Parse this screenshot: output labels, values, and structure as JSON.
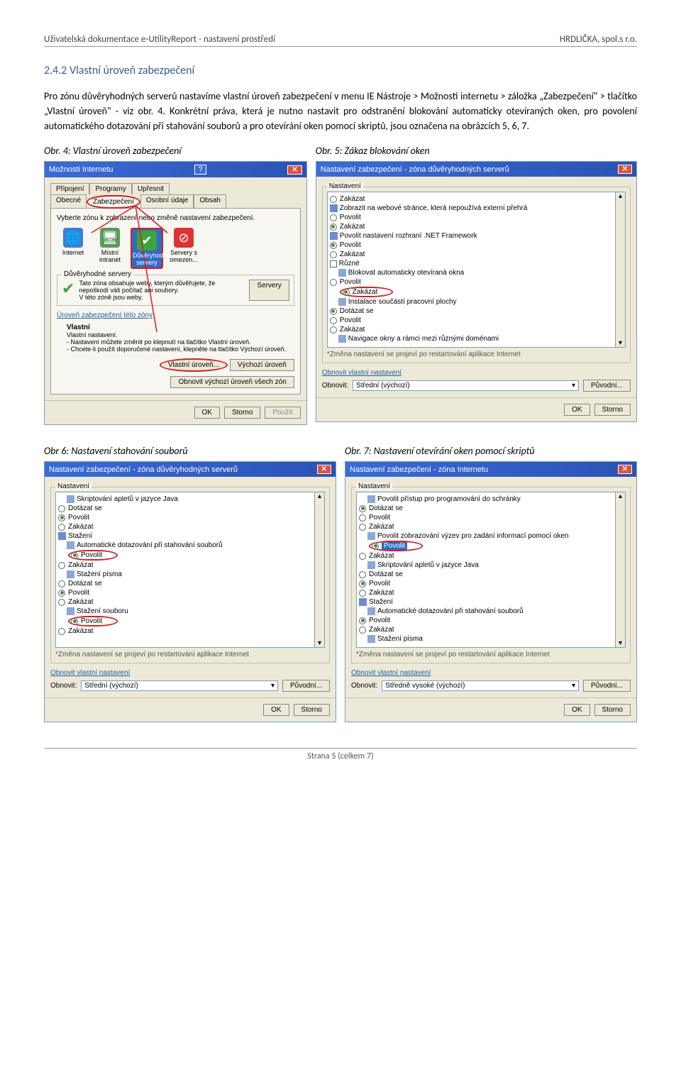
{
  "header": {
    "left": "Uživatelská dokumentace e-UtilityReport  - nastavení prostředí",
    "right": "HRDLIČKA, spol.s r.o."
  },
  "section": {
    "heading": "2.4.2    Vlastní úroveň zabezpečení",
    "body": "Pro zónu důvěryhodných serverů nastavíme vlastní úroveň zabezpečení v menu IE Nástroje > Možnosti internetu > záložka „Zabezpečení\" > tlačítko „Vlastní úroveň\" - viz obr. 4. Konkrétní práva, která je nutno nastavit pro odstranění blokování automaticky otevíraných oken, pro povolení automatického dotazování při stahování souborů a pro otevírání oken pomocí skriptů, jsou označena na obrázcích 5, 6, 7."
  },
  "figs": {
    "f4": {
      "cap": "Obr. 4: Vlastní úroveň zabezpečení"
    },
    "f5": {
      "cap": "Obr. 5: Zákaz blokování  oken"
    },
    "f6": {
      "cap": "Obr 6: Nastavení stahování souborů"
    },
    "f7": {
      "cap": "Obr. 7: Nastavení otevírání oken pomocí skriptů"
    }
  },
  "dlg4": {
    "title": "Možnosti Internetu",
    "tabs_row1": [
      "Připojení",
      "Programy",
      "Upřesnit"
    ],
    "tabs_row2": [
      "Obecné",
      "Zabezpečení",
      "Osobní údaje",
      "Obsah"
    ],
    "zone_prompt": "Vyberte zónu k zobrazení nebo změně nastavení zabezpečení.",
    "zones": [
      "Internet",
      "Místní intranet",
      "Důvěryhodné servery",
      "Servery s omezen..."
    ],
    "trusted_h": "Důvěryhodné servery",
    "trusted_desc": "Tato zóna obsahuje weby, kterým důvěřujete, že nepoškodí váš počítač ani soubory.\nV této zóně jsou weby.",
    "btn_servers": "Servery",
    "level_h": "Úroveň zabezpečení této zóny",
    "custom_h": "Vlastní",
    "custom_desc": "Vlastní nastavení.\n- Nastavení můžete změnit po klepnutí na tlačítko Vlastní úroveň.\n- Chcete-li použít doporučené nastavení, klepněte na tlačítko Výchozí úroveň.",
    "btn_custom": "Vlastní úroveň...",
    "btn_default": "Výchozí úroveň",
    "btn_reset_all": "Obnovit výchozí úroveň všech zón",
    "ok": "OK",
    "cancel": "Storno",
    "apply": "Použít"
  },
  "dlg5": {
    "title": "Nastavení zabezpečení - zóna důvěryhodných serverů",
    "group": "Nastavení",
    "items": [
      {
        "t": "opt",
        "label": "Zakázat",
        "checked": false
      },
      {
        "t": "hdr",
        "label": "Zobrazit na webové stránce, která nepoužívá externí přehrá"
      },
      {
        "t": "opt",
        "label": "Povolit",
        "checked": false
      },
      {
        "t": "opt",
        "label": "Zakázat",
        "checked": true
      },
      {
        "t": "hdr",
        "label": "Povolit nastavení rozhraní .NET Framework"
      },
      {
        "t": "opt",
        "label": "Povolit",
        "checked": true
      },
      {
        "t": "opt",
        "label": "Zakázat",
        "checked": false
      },
      {
        "t": "hdr",
        "label": "Různé",
        "chk": true
      },
      {
        "t": "sub",
        "label": "Blokovat automaticky otevíraná okna"
      },
      {
        "t": "opt",
        "label": "Povolit",
        "checked": false
      },
      {
        "t": "opt",
        "label": "Zakázat",
        "checked": true,
        "circled": true
      },
      {
        "t": "sub",
        "label": "Instalace součástí pracovní plochy"
      },
      {
        "t": "opt",
        "label": "Dotázat se",
        "checked": true
      },
      {
        "t": "opt",
        "label": "Povolit",
        "checked": false
      },
      {
        "t": "opt",
        "label": "Zakázat",
        "checked": false
      },
      {
        "t": "sub",
        "label": "Navigace okny a rámci mezi různými doménami"
      }
    ],
    "hint": "*Změna nastavení se projeví po restartování aplikace Internet",
    "reset_h": "Obnovit vlastní nastavení",
    "reset_lbl": "Obnovit:",
    "reset_sel": "Střední (výchozí)",
    "btn_reset": "Původní...",
    "ok": "OK",
    "cancel": "Storno"
  },
  "dlg6": {
    "title": "Nastavení zabezpečení - zóna důvěryhodných serverů",
    "group": "Nastavení",
    "items": [
      {
        "t": "sub",
        "label": "Skriptování apletů v jazyce Java"
      },
      {
        "t": "opt",
        "label": "Dotázat se",
        "checked": false
      },
      {
        "t": "opt",
        "label": "Povolit",
        "checked": true
      },
      {
        "t": "opt",
        "label": "Zakázat",
        "checked": false
      },
      {
        "t": "hdr",
        "label": "Stažení"
      },
      {
        "t": "sub",
        "label": "Automatické dotazování při stahování souborů"
      },
      {
        "t": "opt",
        "label": "Povolit",
        "checked": true,
        "circled": true
      },
      {
        "t": "opt",
        "label": "Zakázat",
        "checked": false
      },
      {
        "t": "sub",
        "label": "Stažení písma"
      },
      {
        "t": "opt",
        "label": "Dotázat se",
        "checked": false
      },
      {
        "t": "opt",
        "label": "Povolit",
        "checked": true
      },
      {
        "t": "opt",
        "label": "Zakázat",
        "checked": false
      },
      {
        "t": "sub",
        "label": "Stažení souboru"
      },
      {
        "t": "opt",
        "label": "Povolit",
        "checked": true,
        "circled": true
      },
      {
        "t": "opt",
        "label": "Zakázat",
        "checked": false
      }
    ],
    "hint": "*Změna nastavení se projeví po restartování aplikace Internet",
    "reset_h": "Obnovit vlastní nastavení",
    "reset_lbl": "Obnovit:",
    "reset_sel": "Střední (výchozí)",
    "btn_reset": "Původní...",
    "ok": "OK",
    "cancel": "Storno"
  },
  "dlg7": {
    "title": "Nastavení zabezpečení - zóna Internetu",
    "group": "Nastavení",
    "items": [
      {
        "t": "sub",
        "label": "Povolit přístup pro programování do schránky"
      },
      {
        "t": "opt",
        "label": "Dotázat se",
        "checked": true
      },
      {
        "t": "opt",
        "label": "Povolit",
        "checked": false
      },
      {
        "t": "opt",
        "label": "Zakázat",
        "checked": false
      },
      {
        "t": "sub",
        "label": "Povolit zobrazování výzev pro zadání informací pomocí oken"
      },
      {
        "t": "opt",
        "label": "Povolit",
        "checked": true,
        "circled": true,
        "highlight": true
      },
      {
        "t": "opt",
        "label": "Zakázat",
        "checked": false
      },
      {
        "t": "sub",
        "label": "Skriptování apletů v jazyce Java"
      },
      {
        "t": "opt",
        "label": "Dotázat se",
        "checked": false
      },
      {
        "t": "opt",
        "label": "Povolit",
        "checked": true
      },
      {
        "t": "opt",
        "label": "Zakázat",
        "checked": false
      },
      {
        "t": "hdr",
        "label": "Stažení"
      },
      {
        "t": "sub",
        "label": "Automatické dotazování při stahování souborů"
      },
      {
        "t": "opt",
        "label": "Povolit",
        "checked": true
      },
      {
        "t": "opt",
        "label": "Zakázat",
        "checked": false
      },
      {
        "t": "sub",
        "label": "Stažení písma"
      }
    ],
    "hint": "*Změna nastavení se projeví po restartování aplikace Internet",
    "reset_h": "Obnovit vlastní nastavení",
    "reset_lbl": "Obnovit:",
    "reset_sel": "Středně vysoké (výchozí)",
    "btn_reset": "Původní...",
    "ok": "OK",
    "cancel": "Storno"
  },
  "footer": "Strana 5 (celkem 7)"
}
